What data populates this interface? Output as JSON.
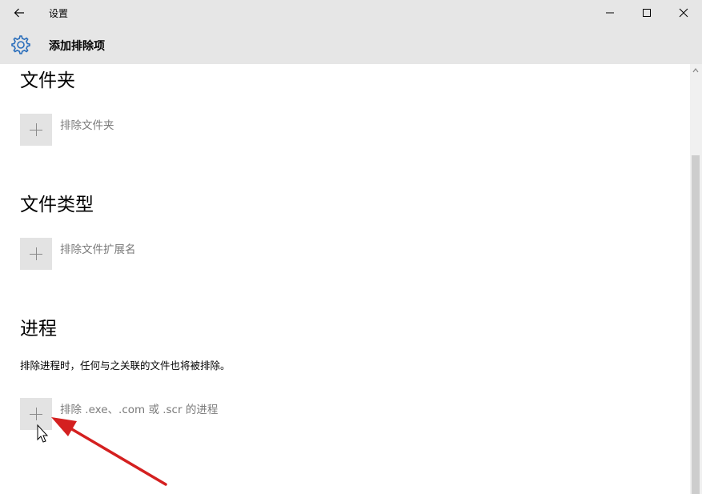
{
  "window": {
    "title": "设置",
    "controls": [
      "minimize",
      "maximize",
      "close"
    ]
  },
  "header": {
    "title": "添加排除项",
    "icon": "gear-icon"
  },
  "sections": [
    {
      "title": "文件夹",
      "add_label": "排除文件夹"
    },
    {
      "title": "文件类型",
      "add_label": "排除文件扩展名"
    },
    {
      "title": "进程",
      "description": "排除进程时，任何与之关联的文件也将被排除。",
      "add_label": "排除 .exe、.com 或 .scr 的进程"
    }
  ],
  "annotation": {
    "arrow_color": "#d42020"
  }
}
